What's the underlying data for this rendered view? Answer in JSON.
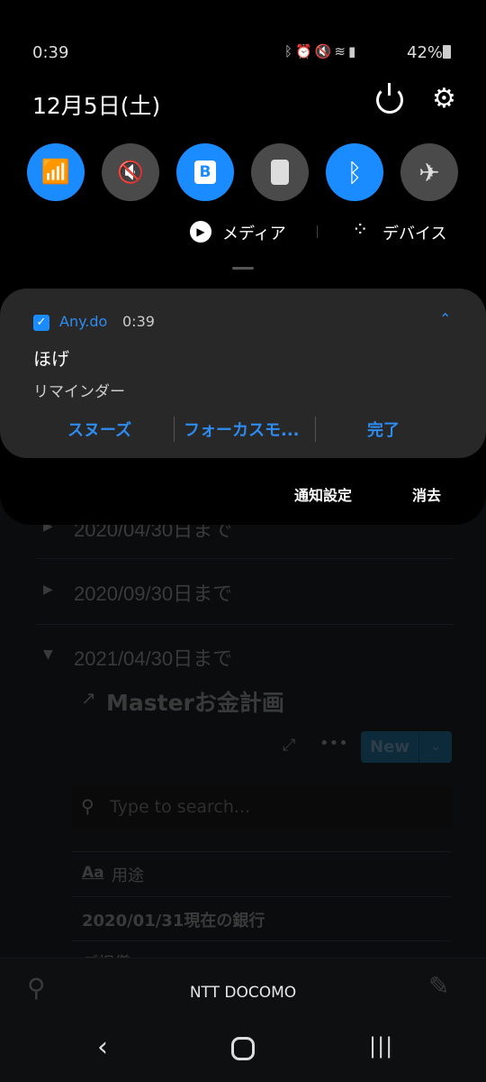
{
  "status_bar": {
    "time": "0:39",
    "battery": "42%",
    "icons": [
      "bluetooth-icon",
      "alarm-icon",
      "mute-icon",
      "wifi-icon",
      "volte-icon",
      "signal-icon",
      "battery-icon"
    ]
  },
  "panel": {
    "date": "12月5日(土)",
    "media_label": "メディア",
    "devices_label": "デバイス",
    "quick_settings": [
      {
        "name": "wifi",
        "on": true
      },
      {
        "name": "mute",
        "on": false
      },
      {
        "name": "b-app",
        "on": true
      },
      {
        "name": "lock",
        "on": false
      },
      {
        "name": "bluetooth",
        "on": true
      },
      {
        "name": "airplane",
        "on": false
      }
    ]
  },
  "notification": {
    "app": "Any.do",
    "time": "0:39",
    "title": "ほげ",
    "text": "リマインダー",
    "actions": [
      "スヌーズ",
      "フォーカスモ...",
      "完了"
    ]
  },
  "footer": {
    "settings": "通知設定",
    "clear": "消去"
  },
  "background_app": {
    "groups": [
      "2020/04/30日まで",
      "2020/09/30日まで",
      "2021/04/30日まで"
    ],
    "page_link": "Masterお金計画",
    "new_button": "New",
    "search_placeholder": "Type to search...",
    "column_icon": "Aa",
    "column": "用途",
    "rows": [
      "2020/01/31現在の銀行",
      "ご祝儀"
    ]
  },
  "carrier": "NTT DOCOMO",
  "colors": {
    "accent": "#1a8cff",
    "card": "#282828"
  }
}
